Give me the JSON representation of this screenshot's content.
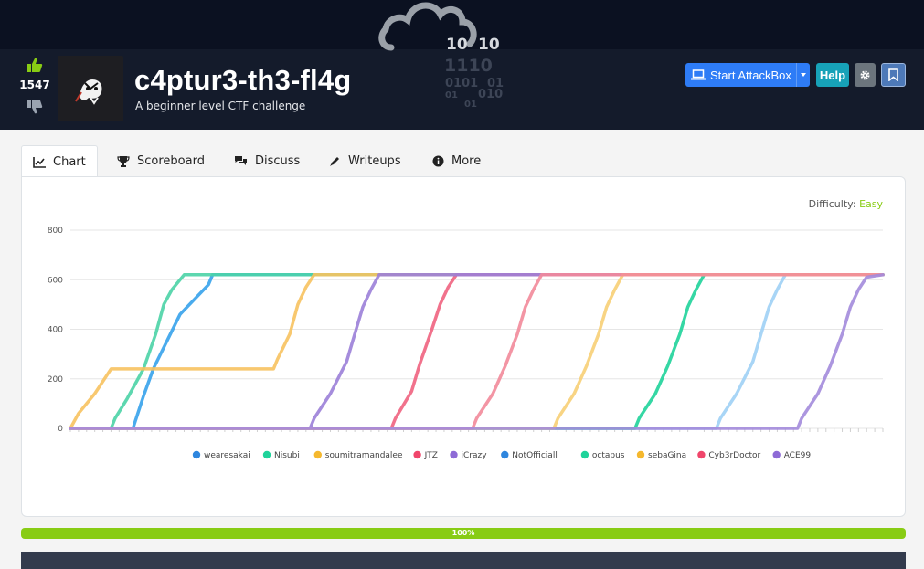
{
  "header": {
    "votes": "1547",
    "title": "c4ptur3-th3-fl4g",
    "subtitle": "A beginner level CTF challenge",
    "banner_bits": [
      "10",
      "10",
      "1110",
      "0101",
      "01",
      "01",
      "010",
      "01"
    ],
    "buttons": {
      "attackbox": "Start AttackBox",
      "help": "Help"
    }
  },
  "tabs": [
    {
      "label": "Chart",
      "icon": "chart-line-icon"
    },
    {
      "label": "Scoreboard",
      "icon": "trophy-icon"
    },
    {
      "label": "Discuss",
      "icon": "comments-icon"
    },
    {
      "label": "Writeups",
      "icon": "pen-icon"
    },
    {
      "label": "More",
      "icon": "info-circle-icon"
    }
  ],
  "difficulty": {
    "label": "Difficulty:",
    "value": "Easy"
  },
  "progress": {
    "value": 1.0,
    "label": "100%"
  },
  "chart_data": {
    "type": "line",
    "ylim": [
      0,
      800
    ],
    "yticks": [
      0,
      200,
      400,
      600,
      800
    ],
    "grid": true,
    "legend": "bottom",
    "series": [
      {
        "name": "wearesakai",
        "color": "#36a2eb",
        "points": [
          [
            0,
            0
          ],
          [
            0.077,
            0
          ],
          [
            0.08,
            30
          ],
          [
            0.09,
            130
          ],
          [
            0.102,
            240
          ],
          [
            0.12,
            360
          ],
          [
            0.135,
            460
          ],
          [
            0.17,
            580
          ],
          [
            0.175,
            620
          ],
          [
            1,
            620
          ]
        ]
      },
      {
        "name": "Nisubi",
        "color": "#4bd3a6",
        "points": [
          [
            0,
            0
          ],
          [
            0.05,
            0
          ],
          [
            0.055,
            40
          ],
          [
            0.07,
            120
          ],
          [
            0.09,
            240
          ],
          [
            0.105,
            380
          ],
          [
            0.115,
            500
          ],
          [
            0.125,
            560
          ],
          [
            0.14,
            620
          ],
          [
            1,
            620
          ]
        ]
      },
      {
        "name": "soumitramandalee",
        "color": "#f7c25f",
        "points": [
          [
            0,
            0
          ],
          [
            0.01,
            60
          ],
          [
            0.03,
            140
          ],
          [
            0.05,
            240
          ],
          [
            0.25,
            240
          ],
          [
            0.255,
            280
          ],
          [
            0.27,
            380
          ],
          [
            0.28,
            500
          ],
          [
            0.29,
            570
          ],
          [
            0.3,
            620
          ],
          [
            1,
            620
          ]
        ]
      },
      {
        "name": "JTZ",
        "color": "#f0637f",
        "points": [
          [
            0,
            0
          ],
          [
            0.395,
            0
          ],
          [
            0.4,
            40
          ],
          [
            0.42,
            150
          ],
          [
            0.43,
            260
          ],
          [
            0.445,
            400
          ],
          [
            0.455,
            500
          ],
          [
            0.465,
            570
          ],
          [
            0.475,
            620
          ],
          [
            1,
            620
          ]
        ]
      },
      {
        "name": "iCrazy",
        "color": "#9b7fd8",
        "points": [
          [
            0,
            0
          ],
          [
            0.295,
            0
          ],
          [
            0.3,
            40
          ],
          [
            0.32,
            140
          ],
          [
            0.34,
            270
          ],
          [
            0.35,
            380
          ],
          [
            0.36,
            490
          ],
          [
            0.37,
            560
          ],
          [
            0.38,
            620
          ],
          [
            1,
            620
          ]
        ]
      },
      {
        "name": "NotOfficiall",
        "color": "#9fd0f5",
        "points": [
          [
            0,
            0
          ],
          [
            0.795,
            0
          ],
          [
            0.8,
            40
          ],
          [
            0.82,
            140
          ],
          [
            0.84,
            270
          ],
          [
            0.85,
            380
          ],
          [
            0.86,
            490
          ],
          [
            0.87,
            560
          ],
          [
            0.88,
            620
          ],
          [
            1,
            620
          ]
        ]
      },
      {
        "name": "octapus",
        "color": "#1fd39a",
        "points": [
          [
            0,
            0
          ],
          [
            0.695,
            0
          ],
          [
            0.7,
            40
          ],
          [
            0.72,
            140
          ],
          [
            0.735,
            250
          ],
          [
            0.75,
            380
          ],
          [
            0.76,
            490
          ],
          [
            0.77,
            560
          ],
          [
            0.78,
            620
          ],
          [
            1,
            620
          ]
        ]
      },
      {
        "name": "sebaGina",
        "color": "#f7cf75",
        "points": [
          [
            0,
            0
          ],
          [
            0.595,
            0
          ],
          [
            0.6,
            40
          ],
          [
            0.62,
            140
          ],
          [
            0.635,
            250
          ],
          [
            0.65,
            380
          ],
          [
            0.66,
            490
          ],
          [
            0.67,
            560
          ],
          [
            0.68,
            620
          ],
          [
            1,
            620
          ]
        ]
      },
      {
        "name": "Cyb3rDoctor",
        "color": "#f28a9a",
        "points": [
          [
            0,
            0
          ],
          [
            0.495,
            0
          ],
          [
            0.5,
            40
          ],
          [
            0.52,
            140
          ],
          [
            0.535,
            250
          ],
          [
            0.55,
            380
          ],
          [
            0.56,
            490
          ],
          [
            0.57,
            560
          ],
          [
            0.58,
            620
          ],
          [
            1,
            620
          ]
        ]
      },
      {
        "name": "ACE99",
        "color": "#a38bdc",
        "points": [
          [
            0,
            0
          ],
          [
            0.895,
            0
          ],
          [
            0.9,
            40
          ],
          [
            0.92,
            140
          ],
          [
            0.935,
            250
          ],
          [
            0.95,
            380
          ],
          [
            0.96,
            490
          ],
          [
            0.97,
            560
          ],
          [
            0.98,
            610
          ],
          [
            1,
            620
          ]
        ]
      }
    ],
    "legend_colors": [
      "#2e86de",
      "#1fd39a",
      "#f5b82e",
      "#f0466b",
      "#8e6bd6",
      "#2e86de",
      "#1fd39a",
      "#f5b82e",
      "#f0466b",
      "#8e6bd6"
    ]
  }
}
